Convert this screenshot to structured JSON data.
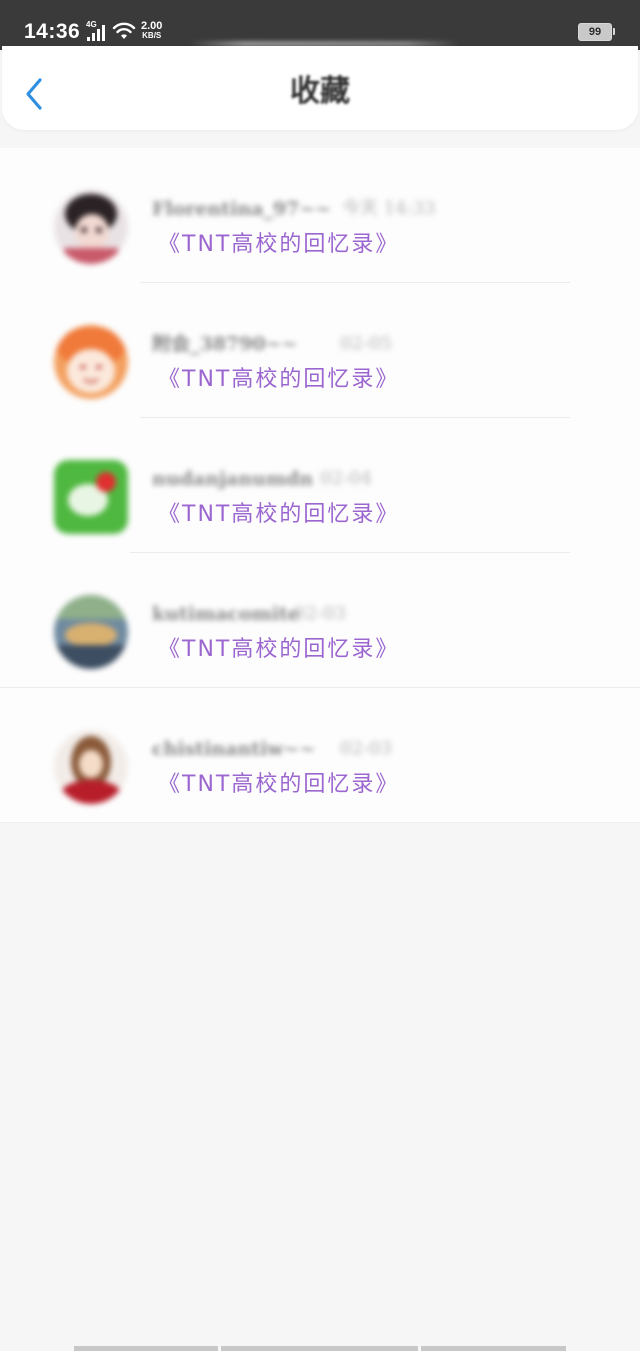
{
  "status_bar": {
    "time": "14:36",
    "network_type": "4G",
    "speed_value": "2.00",
    "speed_unit": "KB/S",
    "battery": "99"
  },
  "header": {
    "title": "收藏",
    "back_icon": "chevron-left-icon"
  },
  "colors": {
    "accent": "#2f8fe0",
    "book_title": "#9b66cf",
    "status_bar_bg": "#3a3a3a"
  },
  "favorites": [
    {
      "username": "Florentina_97~~",
      "time": "今天 14:33",
      "title": "《TNT高校的回忆录》"
    },
    {
      "username": "附会_38790~~",
      "time": "02-05",
      "title": "《TNT高校的回忆录》"
    },
    {
      "username": "nudanjanumdn",
      "time": "02-04",
      "title": "《TNT高校的回忆录》"
    },
    {
      "username": "kutimacomite",
      "time": "02-03",
      "title": "《TNT高校的回忆录》"
    },
    {
      "username": "chistinantiw~~",
      "time": "02-03",
      "title": "《TNT高校的回忆录》"
    }
  ]
}
